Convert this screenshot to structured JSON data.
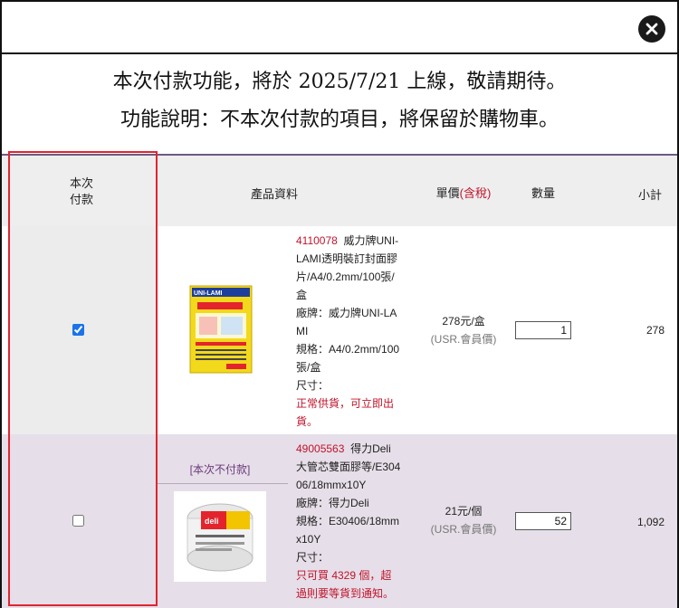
{
  "dialog": {
    "close_icon": "close-icon"
  },
  "notice": {
    "line1": "本次付款功能，將於 2025/7/21 上線，敬請期待。",
    "line2": "功能說明：不本次付款的項目，將保留於購物車。"
  },
  "table": {
    "headers": {
      "pay_line1": "本次",
      "pay_line2": "付款",
      "info": "產品資料",
      "price": "單價",
      "price_tax": "(含稅)",
      "qty": "數量",
      "subtotal": "小計"
    },
    "rows": [
      {
        "checked": true,
        "code": "4110078",
        "name": "威力牌UNI-LAMI透明裝訂封面膠片/A4/0.2mm/100張/盒",
        "brand": "廠牌：威力牌UNI-LAMI",
        "spec": "規格：A4/0.2mm/100張/盒",
        "size": "尺寸：",
        "stock": "正常供貨，可立即出貨。",
        "price": "278元/盒",
        "member": "(USR.會員價)",
        "qty": "1",
        "subtotal": "278",
        "image_text": "UNI-LAMI 透明封面膠片",
        "accent": "#f2d21a"
      },
      {
        "checked": false,
        "tag": "[本次不付款]",
        "code": "49005563",
        "name": "得力Deli大管芯雙面膠等/E30406/18mmx10Y",
        "brand": "廠牌：得力Deli",
        "spec": "規格：E30406/18mmx10Y",
        "size": "尺寸：",
        "stock": "只可買 4329 個，超過則要等貨到通知。",
        "price": "21元/個",
        "member": "(USR.會員價)",
        "qty": "52",
        "subtotal": "1,092",
        "image_text": "deli",
        "accent": "#e4242c"
      }
    ]
  },
  "colors": {
    "highlight_border": "#e0252f",
    "header_band": "#6e5a86",
    "unpaid_row_bg": "#e6dee8",
    "code_red": "#c0142b"
  }
}
